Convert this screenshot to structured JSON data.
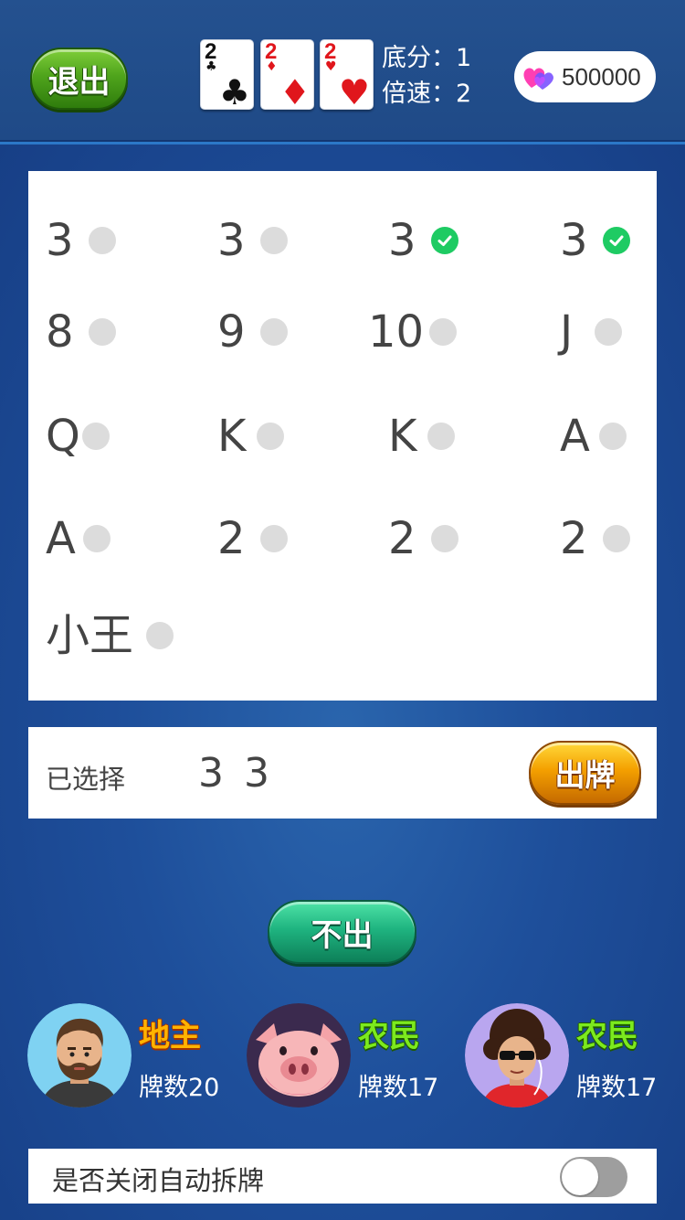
{
  "header": {
    "exit_label": "退出",
    "landlord_cards": [
      {
        "rank": "2",
        "suit": "♣",
        "color": "#111111"
      },
      {
        "rank": "2",
        "suit": "♦",
        "color": "#e0161c"
      },
      {
        "rank": "2",
        "suit": "♥",
        "color": "#e0161c"
      }
    ],
    "base_score": "底分：1",
    "multiplier": "倍速：2",
    "coins": "500000"
  },
  "hand": [
    {
      "label": "3",
      "checked": false
    },
    {
      "label": "3",
      "checked": false
    },
    {
      "label": "3",
      "checked": true
    },
    {
      "label": "3",
      "checked": true
    },
    {
      "label": "8",
      "checked": false
    },
    {
      "label": "9",
      "checked": false
    },
    {
      "label": "10",
      "checked": false
    },
    {
      "label": "J",
      "checked": false
    },
    {
      "label": "Q",
      "checked": false
    },
    {
      "label": "K",
      "checked": false
    },
    {
      "label": "K",
      "checked": false
    },
    {
      "label": "A",
      "checked": false
    },
    {
      "label": "A",
      "checked": false
    },
    {
      "label": "2",
      "checked": false
    },
    {
      "label": "2",
      "checked": false
    },
    {
      "label": "2",
      "checked": false
    },
    {
      "label": "小王",
      "checked": false
    }
  ],
  "selection": {
    "title": "已选择",
    "cards": "3 3",
    "play_label": "出牌"
  },
  "pass_label": "不出",
  "players": [
    {
      "role": "地主",
      "count": "牌数20",
      "avatar": "man-beard-avatar"
    },
    {
      "role": "农民",
      "count": "牌数17",
      "avatar": "pig-avatar"
    },
    {
      "role": "农民",
      "count": "牌数17",
      "avatar": "curly-hair-sunglasses-avatar"
    }
  ],
  "settings": {
    "auto_split_label": "是否关闭自动拆牌",
    "auto_split_on": false
  },
  "colors": {
    "background": "#1d4a93",
    "check": "#1ecb63",
    "landlord_role": "#ffb400",
    "farmer_role": "#7cea1e"
  }
}
